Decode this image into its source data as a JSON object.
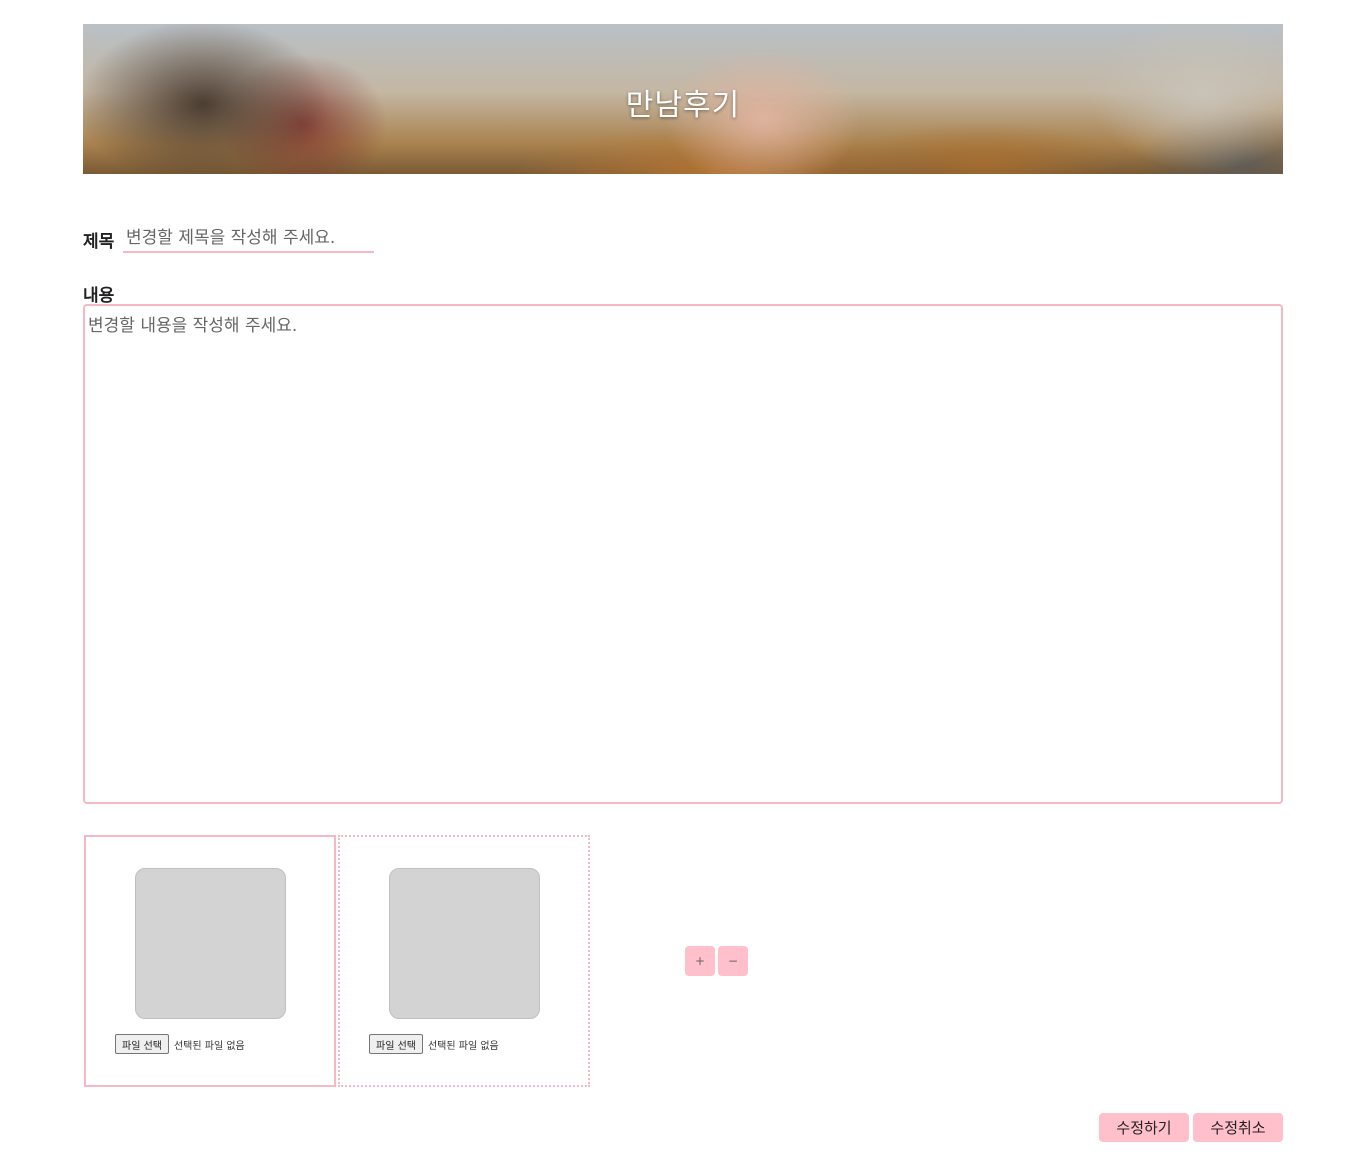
{
  "banner": {
    "title": "만남후기"
  },
  "form": {
    "title_label": "제목",
    "title_placeholder": "변경할 제목을 작성해 주세요.",
    "content_label": "내용",
    "content_placeholder": "변경할 내용을 작성해 주세요."
  },
  "uploads": [
    {
      "button_label": "파일 선택",
      "status": "선택된 파일 없음"
    },
    {
      "button_label": "파일 선택",
      "status": "선택된 파일 없음"
    }
  ],
  "controls": {
    "add_label": "+",
    "remove_label": "−"
  },
  "actions": {
    "submit_label": "수정하기",
    "cancel_label": "수정취소"
  },
  "colors": {
    "accent": "#ffc0cb",
    "border": "#f6b8c4",
    "preview_bg": "#d3d3d3"
  }
}
